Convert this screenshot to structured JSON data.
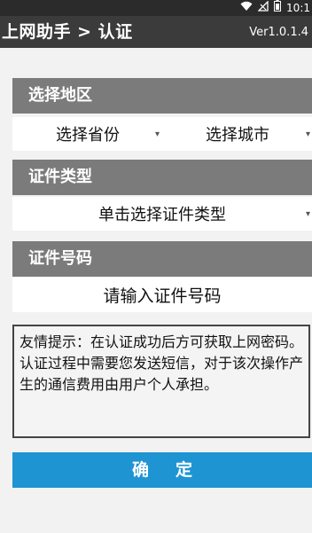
{
  "status_bar": {
    "time": "10:1"
  },
  "header": {
    "title": "上网助手 > 认证",
    "version": "Ver1.0.1.4"
  },
  "region_section": {
    "label": "选择地区",
    "province_select": "选择省份",
    "city_select": "选择城市"
  },
  "id_type_section": {
    "label": "证件类型",
    "type_select": "单击选择证件类型"
  },
  "id_number_section": {
    "label": "证件号码",
    "placeholder": "请输入证件号码"
  },
  "tip": {
    "text": "友情提示：在认证成功后方可获取上网密码。认证过程中需要您发送短信，对于该次操作产生的通信费用由用户个人承担。"
  },
  "confirm_button": {
    "label": "确定"
  }
}
